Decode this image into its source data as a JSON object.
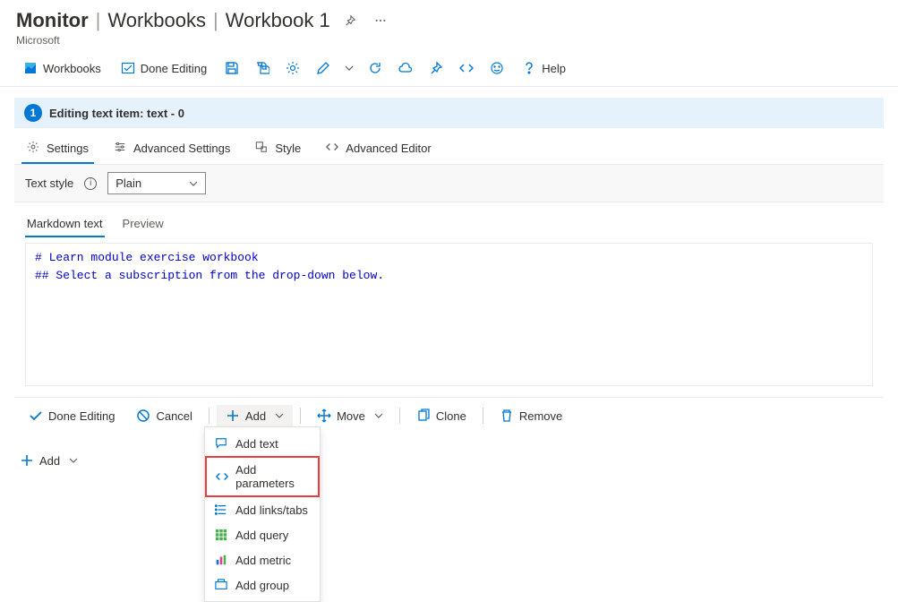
{
  "header": {
    "service": "Monitor",
    "section": "Workbooks",
    "name": "Workbook 1",
    "tenant": "Microsoft"
  },
  "cmdbar": {
    "workbooks": "Workbooks",
    "done_editing": "Done Editing",
    "help": "Help"
  },
  "editing_panel": {
    "badge": "1",
    "title": "Editing text item: text - 0",
    "tabs": {
      "settings": "Settings",
      "advanced_settings": "Advanced Settings",
      "style": "Style",
      "advanced_editor": "Advanced Editor"
    },
    "text_style_label": "Text style",
    "text_style_value": "Plain",
    "inner_tabs": {
      "markdown": "Markdown text",
      "preview": "Preview"
    },
    "editor_lines": [
      "# Learn module exercise workbook",
      "## Select a subscription from the drop-down below."
    ],
    "footer": {
      "done_editing": "Done Editing",
      "cancel": "Cancel",
      "add": "Add",
      "move": "Move",
      "clone": "Clone",
      "remove": "Remove"
    }
  },
  "add_menu": {
    "add_text": "Add text",
    "add_parameters": "Add parameters",
    "add_links_tabs": "Add links/tabs",
    "add_query": "Add query",
    "add_metric": "Add metric",
    "add_group": "Add group"
  },
  "page_footer": {
    "add": "Add"
  }
}
